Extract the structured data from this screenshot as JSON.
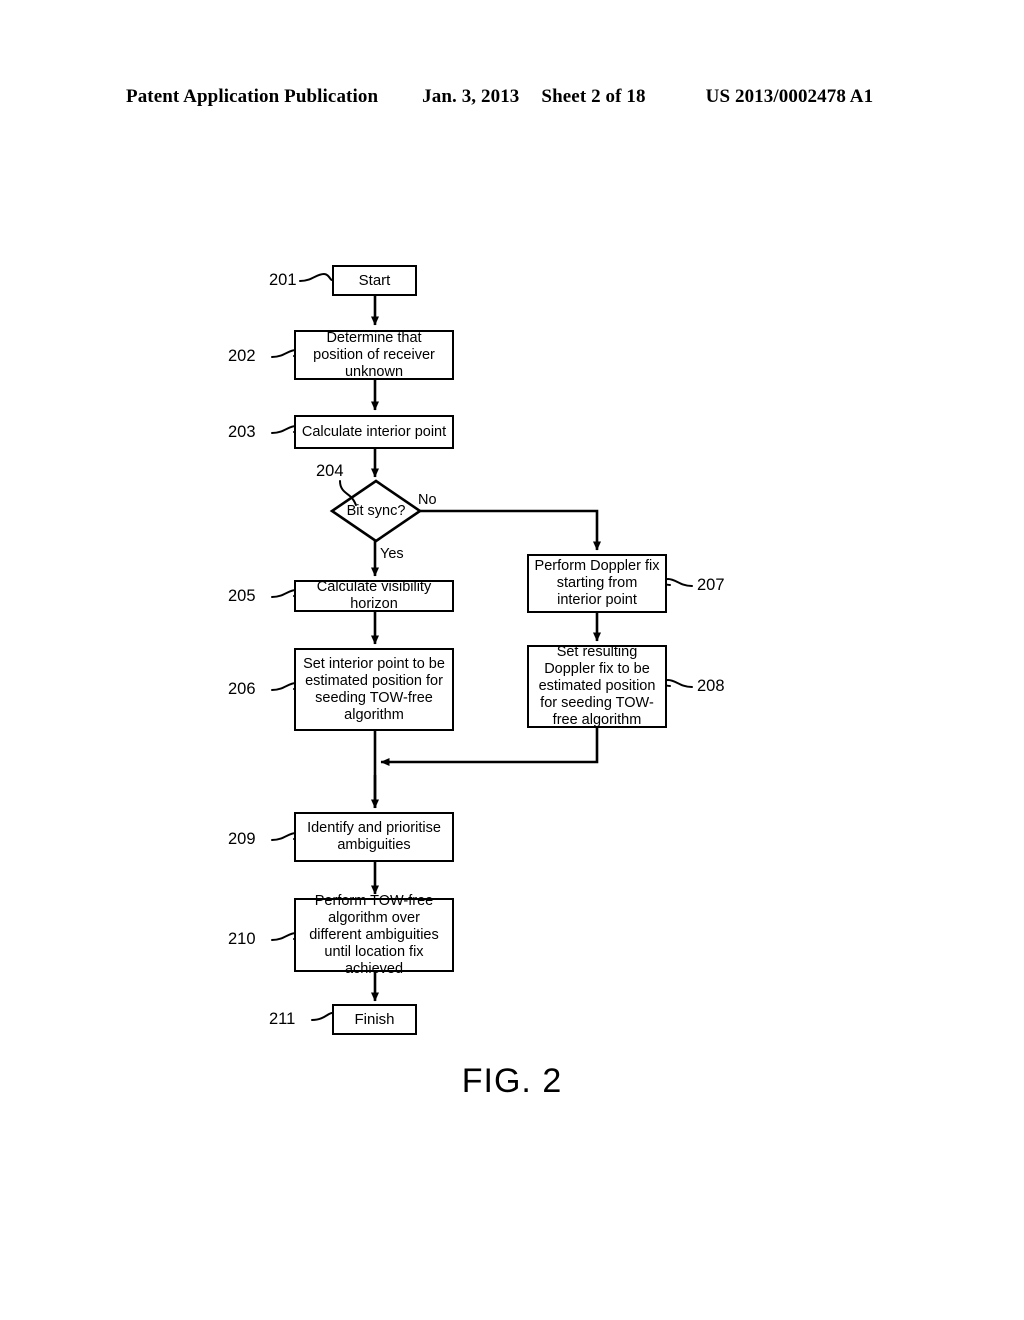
{
  "header": {
    "publication": "Patent Application Publication",
    "date": "Jan. 3, 2013",
    "sheet": "Sheet 2 of 18",
    "patent_number": "US 2013/0002478 A1"
  },
  "figure": {
    "caption": "FIG. 2",
    "type": "flowchart"
  },
  "flowchart": {
    "nodes": [
      {
        "ref": "201",
        "shape": "terminal",
        "text": "Start"
      },
      {
        "ref": "202",
        "shape": "process",
        "text": "Determine that position of receiver unknown"
      },
      {
        "ref": "203",
        "shape": "process",
        "text": "Calculate interior point"
      },
      {
        "ref": "204",
        "shape": "decision",
        "text": "Bit sync?"
      },
      {
        "ref": "205",
        "shape": "process",
        "text": "Calculate visibility horizon"
      },
      {
        "ref": "206",
        "shape": "process",
        "text": "Set interior point to be estimated position for seeding TOW-free algorithm"
      },
      {
        "ref": "207",
        "shape": "process",
        "text": "Perform Doppler fix starting from interior point"
      },
      {
        "ref": "208",
        "shape": "process",
        "text": "Set resulting Doppler fix to be estimated position for seeding TOW-free algorithm"
      },
      {
        "ref": "209",
        "shape": "process",
        "text": "Identify and prioritise ambiguities"
      },
      {
        "ref": "210",
        "shape": "process",
        "text": "Perform TOW-free algorithm over different ambiguities until location fix achieved"
      },
      {
        "ref": "211",
        "shape": "terminal",
        "text": "Finish"
      }
    ],
    "branch_labels": {
      "no": "No",
      "yes": "Yes"
    }
  },
  "colors": {
    "stroke": "#000000",
    "background": "#ffffff",
    "text": "#000000"
  }
}
